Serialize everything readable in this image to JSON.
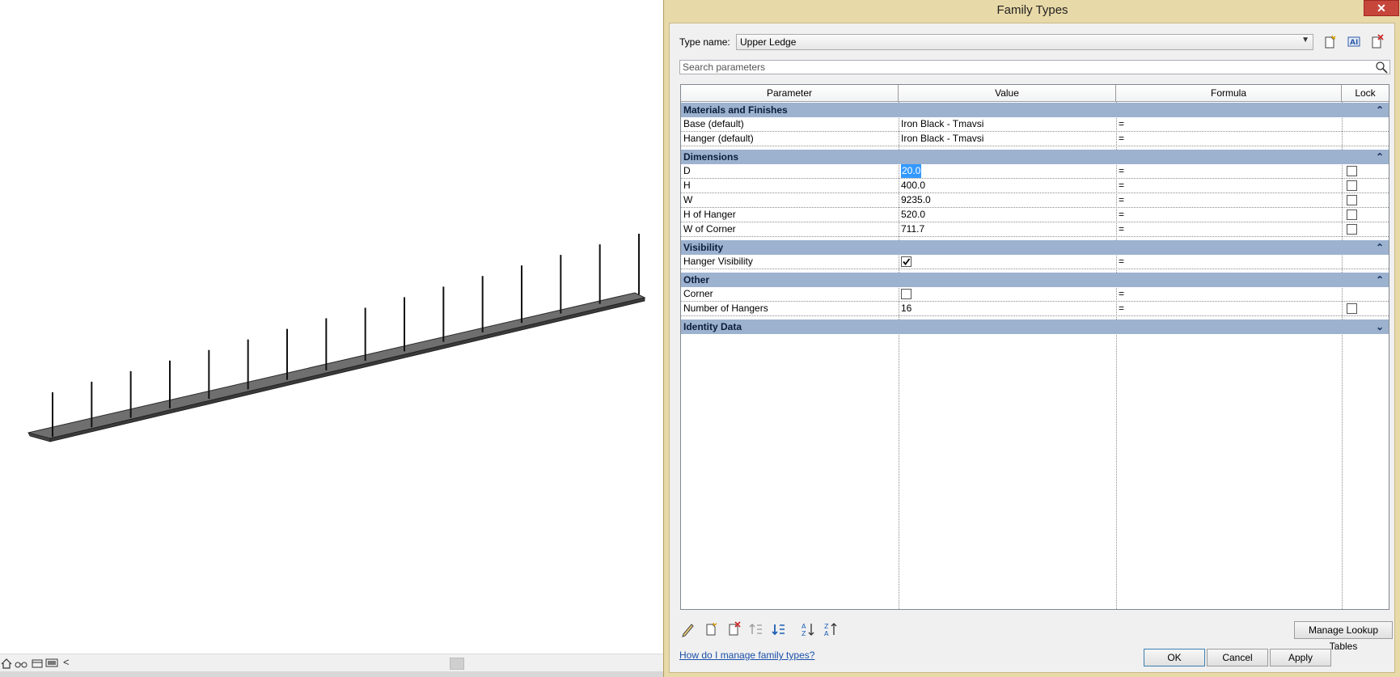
{
  "viewport": {
    "status_icons": [
      "house-icon",
      "binoculars-icon",
      "frame-icon",
      "monitor-icon"
    ],
    "scroll_left_glyph": "<"
  },
  "dialog": {
    "title": "Family Types",
    "close_glyph": "✕",
    "type_name_label": "Type name:",
    "type_name_value": "Upper Ledge",
    "toolbar_icons": [
      "new-type-icon",
      "rename-type-icon",
      "delete-type-icon"
    ],
    "search_placeholder": "Search parameters",
    "columns": [
      "Parameter",
      "Value",
      "Formula",
      "Lock"
    ],
    "groups": [
      {
        "name": "Materials and Finishes",
        "collapse_glyph": "⌃",
        "rows": [
          {
            "param": "Base (default)",
            "value": "Iron Black - Tmavsi",
            "formula": "=",
            "lock": null
          },
          {
            "param": "Hanger (default)",
            "value": "Iron Black - Tmavsi",
            "formula": "=",
            "lock": null
          }
        ]
      },
      {
        "name": "Dimensions",
        "collapse_glyph": "⌃",
        "rows": [
          {
            "param": "D",
            "value": "20.0",
            "formula": "=",
            "lock": false,
            "selected": true
          },
          {
            "param": "H",
            "value": "400.0",
            "formula": "=",
            "lock": false
          },
          {
            "param": "W",
            "value": "9235.0",
            "formula": "=",
            "lock": false
          },
          {
            "param": "H of Hanger",
            "value": "520.0",
            "formula": "=",
            "lock": false
          },
          {
            "param": "W of Corner",
            "value": "711.7",
            "formula": "=",
            "lock": false
          }
        ]
      },
      {
        "name": "Visibility",
        "collapse_glyph": "⌃",
        "rows": [
          {
            "param": "Hanger Visibility",
            "value_checkbox": true,
            "formula": "=",
            "lock": null
          }
        ]
      },
      {
        "name": "Other",
        "collapse_glyph": "⌃",
        "rows": [
          {
            "param": "Corner",
            "value_checkbox": false,
            "formula": "=",
            "lock": null
          },
          {
            "param": "Number of Hangers",
            "value": "16",
            "formula": "=",
            "lock": false
          }
        ]
      },
      {
        "name": "Identity Data",
        "collapse_glyph": "⌄",
        "rows": []
      }
    ],
    "bottom_tool_icons": [
      "edit-parameter-icon",
      "new-parameter-icon",
      "delete-parameter-icon",
      "move-up-icon",
      "move-down-icon",
      "sort-ascending-icon",
      "sort-descending-icon"
    ],
    "manage_lookup_label": "Manage Lookup Tables",
    "help_link": "How do I manage family types?",
    "ok_label": "OK",
    "cancel_label": "Cancel",
    "apply_label": "Apply"
  }
}
